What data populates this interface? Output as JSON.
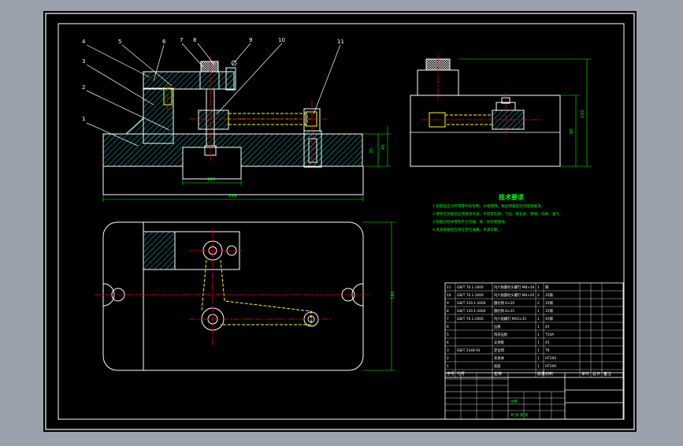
{
  "colors": {
    "background_outer": "#9aa1ad",
    "sheet": "#000000",
    "frame": "#ffffff",
    "hatch": "#00ffff",
    "hidden_lines": "#ffff00",
    "centerlines": "#ff0000",
    "dimensions": "#00ff00",
    "title_text": "#00ff00"
  },
  "callouts": [
    "1",
    "2",
    "3",
    "4",
    "5",
    "6",
    "7",
    "8",
    "9",
    "10",
    "11"
  ],
  "dimensions": {
    "front_width": "246",
    "front_base": "100",
    "front_height_right": "35",
    "front_height_right_2": "45",
    "side_height": "155",
    "side_inner": "95",
    "plan_height": "140"
  },
  "technical_requirements": {
    "title": "技术要求",
    "lines": [
      "1.装配前应对所有零件的毛刺、尖角倒钝，锐边倒角应符合图纸要求。",
      "2.零件在装配前必须清洗干净，不得有毛刺、飞边、氧化皮、锈蚀、切屑、油污。",
      "3.装配过程中零件不允许磕、碰、划伤和锈蚀。",
      "4.夹具装配后应保证定位准确，夹紧可靠。"
    ]
  },
  "bom": {
    "rows": [
      {
        "no": "11",
        "code": "GB/T 70.1-2000",
        "name": "内六角圆柱头螺钉 M8×30",
        "qty": "1",
        "material": "钢",
        "note": ""
      },
      {
        "no": "10",
        "code": "GB/T 70.1-2000",
        "name": "内六角圆柱头螺钉 M6×20",
        "qty": "2",
        "material": "35钢",
        "note": ""
      },
      {
        "no": "9",
        "code": "GB/T 119.1-2000",
        "name": "圆柱销 6×20",
        "qty": "2",
        "material": "35钢",
        "note": ""
      },
      {
        "no": "8",
        "code": "GB/T 119.1-2000",
        "name": "圆柱销 8×25",
        "qty": "1",
        "material": "35钢",
        "note": ""
      },
      {
        "no": "7",
        "code": "GB/T 70.1-2000",
        "name": "内六角螺钉 M10×35",
        "qty": "1",
        "material": "45钢",
        "note": ""
      },
      {
        "no": "6",
        "code": "",
        "name": "压板",
        "qty": "1",
        "material": "45",
        "note": ""
      },
      {
        "no": "5",
        "code": "",
        "name": "钩形压板",
        "qty": "1",
        "material": "T10A",
        "note": ""
      },
      {
        "no": "4",
        "code": "",
        "name": "支承板",
        "qty": "1",
        "material": "45",
        "note": ""
      },
      {
        "no": "3",
        "code": "GB/T 2148-91",
        "name": "定位销",
        "qty": "1",
        "material": "T8",
        "note": ""
      },
      {
        "no": "2",
        "code": "",
        "name": "夹具体",
        "qty": "1",
        "material": "HT200",
        "note": ""
      },
      {
        "no": "1",
        "code": "",
        "name": "底座",
        "qty": "1",
        "material": "HT200",
        "note": ""
      }
    ],
    "header": {
      "no": "序号",
      "code": "代号",
      "name": "名称",
      "qty": "数量",
      "material": "材料",
      "unit_weight": "单件",
      "total_weight": "总计",
      "weight": "重量",
      "note": "备注"
    }
  },
  "title_block": {
    "scale_label": "比例",
    "sheet_label": "共 张 第 张"
  }
}
